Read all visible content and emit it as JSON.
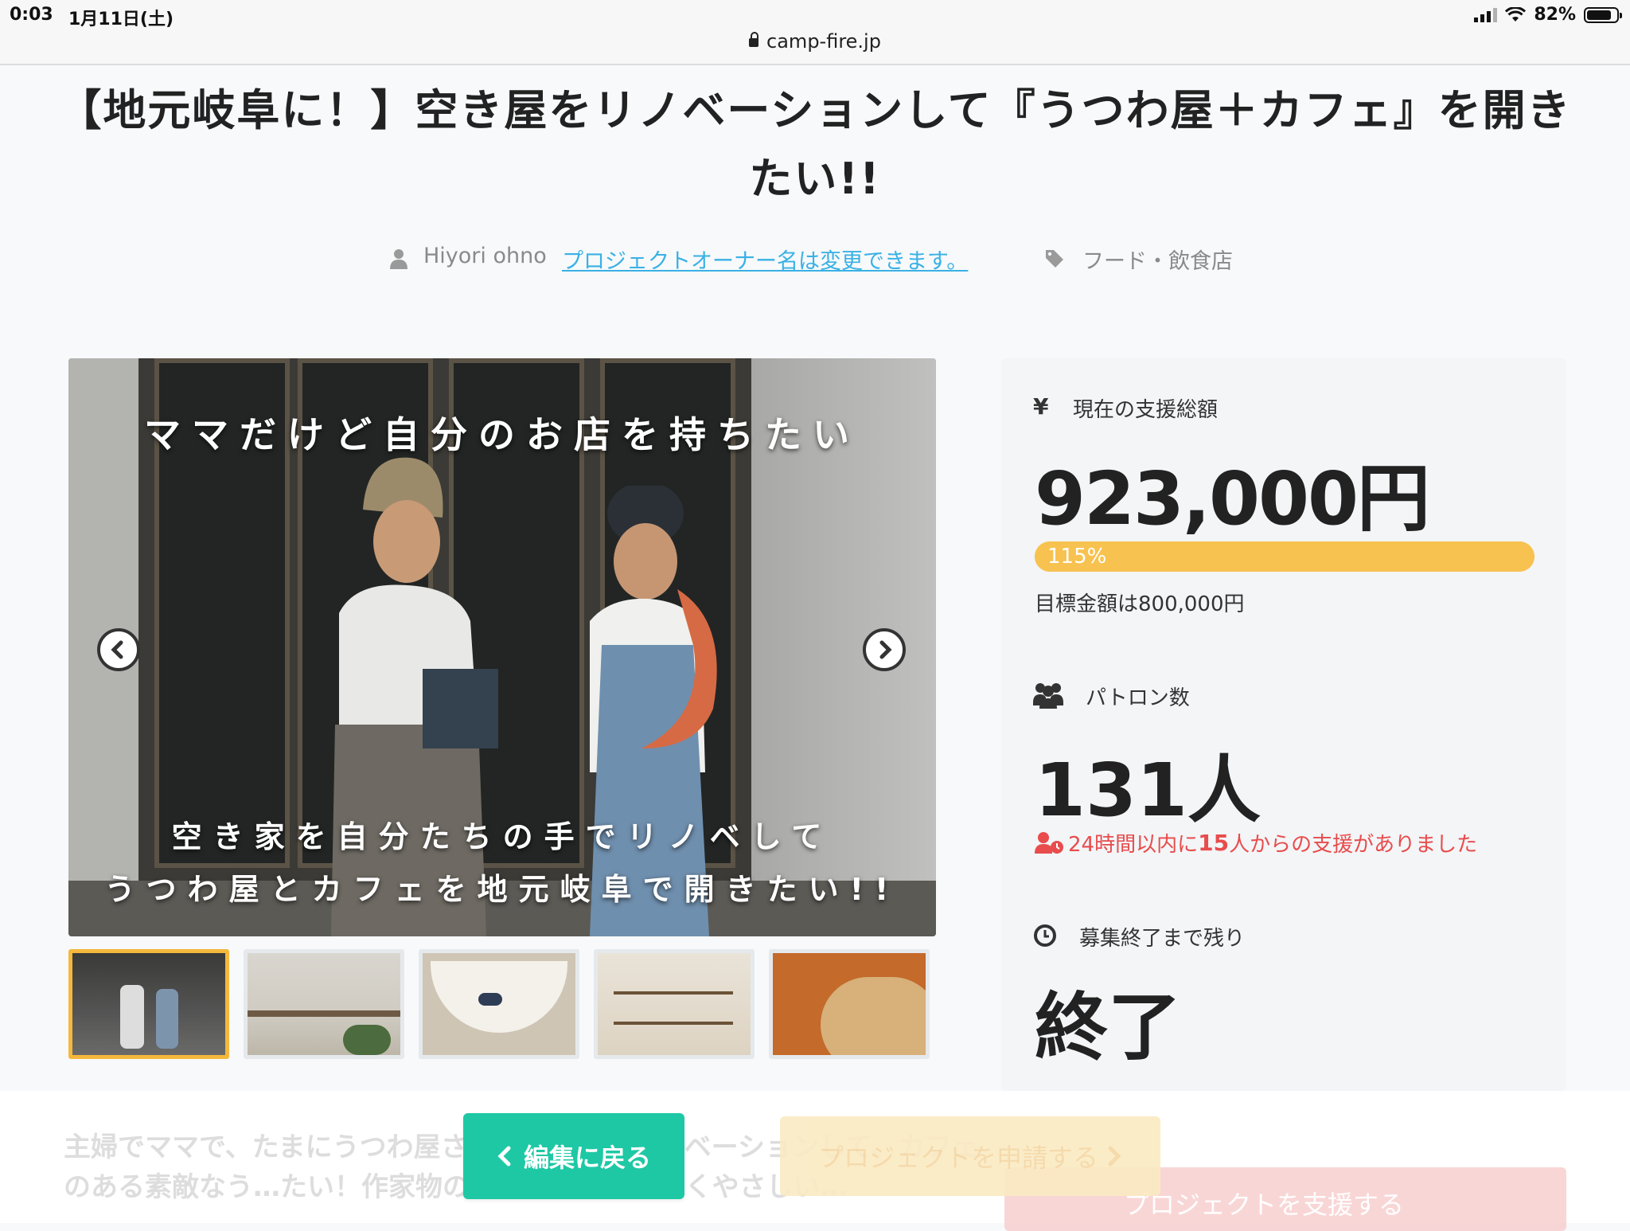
{
  "status_bar": {
    "time": "0:03",
    "date": "1月11日(土)",
    "battery": "82%",
    "battery_level": 0.82
  },
  "browser": {
    "url": "camp-fire.jp"
  },
  "project": {
    "title": "【地元岐阜に！】空き屋をリノベーションして『うつわ屋＋カフェ』を開きたい!!",
    "owner": "Hiyori ohno",
    "owner_link": "プロジェクトオーナー名は変更できます。",
    "category": "フード・飲食店"
  },
  "image": {
    "caption_top": "ママだけど自分のお店を持ちたい",
    "caption_bottom_1": "空き家を自分たちの手でリノベして",
    "caption_bottom_2": "うつわ屋とカフェを地元岐阜で開きたい!!",
    "thumbnail_count": 5,
    "active_thumbnail": 1
  },
  "stats": {
    "amount_label": "現在の支援総額",
    "amount": "923,000円",
    "progress_label": "115%",
    "progress_value": 1.15,
    "goal": "目標金額は800,000円",
    "patrons_label": "パトロン数",
    "patrons": "131人",
    "recent_prefix": "24時間以内に",
    "recent_count": "15",
    "recent_suffix": "人からの支援がありました",
    "remaining_label": "募集終了まで残り",
    "remaining": "終了"
  },
  "body": {
    "text": "主婦でママで、たまにうつわ屋さん…空き家をリノベーションして、カフェのある素敵なう…たい！作家物のうつわで、値が高くやさしい…"
  },
  "actions": {
    "back": "編集に戻る",
    "apply": "プロジェクトを申請する",
    "ghost": "プロジェクトを支援する"
  },
  "colors": {
    "accent": "#1ec8a5",
    "progress": "#f7c250",
    "link": "#3ab1e4",
    "alert": "#e84c4c"
  }
}
